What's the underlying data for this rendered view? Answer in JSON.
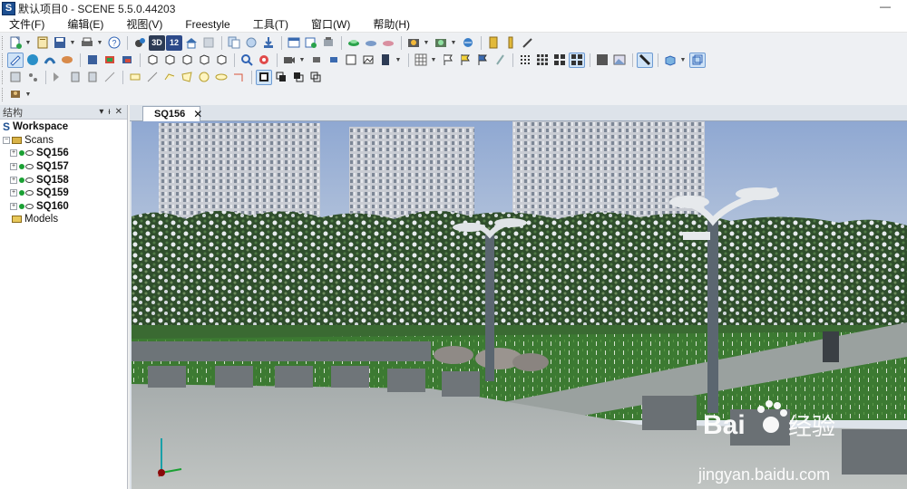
{
  "window": {
    "title": "默认项目0 - SCENE 5.5.0.44203",
    "app_icon_letter": "S",
    "minimize_glyph": "—"
  },
  "menu": {
    "items": [
      "文件(F)",
      "编辑(E)",
      "视图(V)",
      "Freestyle",
      "工具(T)",
      "窗口(W)",
      "帮助(H)"
    ]
  },
  "toolbar": {
    "row1_icons": [
      "new-project-icon",
      "open-icon",
      "save-icon",
      "print-icon",
      "help-icon",
      "scan-icon",
      "3d-view-icon",
      "12-view-icon",
      "home-icon",
      "blank-icon",
      "copy-icon",
      "import-icon",
      "export-icon",
      "sheet-icon",
      "register-icon",
      "stamp-icon",
      "cloud-icon",
      "cloud2-icon",
      "cloud3-icon",
      "camera-icon",
      "camera2-icon",
      "globe-icon",
      "measure-icon",
      "ruler-icon",
      "pen-icon"
    ],
    "row1_text": {
      "threed": "3D",
      "twelve": "12"
    },
    "row2_icons": [
      "select-icon",
      "sphere-icon",
      "pipe-icon",
      "lasso-icon",
      "brush-icon",
      "fill-icon",
      "paint-icon",
      "cube1-icon",
      "cube2-icon",
      "cube3-icon",
      "cube4-icon",
      "cube5-icon",
      "zoom-icon",
      "orbit-icon",
      "video-icon",
      "move-icon",
      "move2-icon",
      "save-view-icon",
      "frame-icon",
      "layer-icon",
      "grid-icon",
      "flag-icon",
      "flag2-icon",
      "flag3-icon",
      "flag4-icon",
      "dots-small-icon",
      "dots-medium-icon",
      "dots-large-icon",
      "dots-xl-icon",
      "grid-fine-icon",
      "grid-image-icon",
      "diagonal-icon",
      "box-icon",
      "box-active-icon"
    ],
    "row3_icons": [
      "clip-icon",
      "clip2-icon",
      "note-icon",
      "note2-icon",
      "note3-icon",
      "dimension-icon",
      "rect-icon",
      "line-icon",
      "polyline-icon",
      "polygon-icon",
      "circle-icon",
      "ellipse-icon",
      "arc-icon",
      "frame1-icon",
      "frame2-icon",
      "frame3-icon",
      "frame4-icon"
    ],
    "row4_icons": [
      "layers-icon"
    ]
  },
  "panel": {
    "title": "结构",
    "controls": [
      "▾",
      "ᵼ",
      "✕"
    ],
    "tree": {
      "workspace": "Workspace",
      "scans": "Scans",
      "scan_items": [
        "SQ156",
        "SQ157",
        "SQ158",
        "SQ159",
        "SQ160"
      ],
      "models": "Models",
      "expand_glyph": "+",
      "collapse_glyph": "−"
    }
  },
  "document": {
    "active_tab": "SQ156",
    "close_glyph": "✕"
  },
  "viewport": {
    "scene": "point-cloud-park",
    "axis_labels": {
      "x": "",
      "y": "",
      "z": ""
    },
    "watermark": {
      "brand": "Bai",
      "brand_cn": "经验",
      "url": "jingyan.baidu.com"
    },
    "colors": {
      "sky": "#9fb5d8",
      "grass": "#3f7d34",
      "pavement": "#aab0b0",
      "trees": "#2d4a2a",
      "buildings": "#c8ccd3"
    }
  }
}
